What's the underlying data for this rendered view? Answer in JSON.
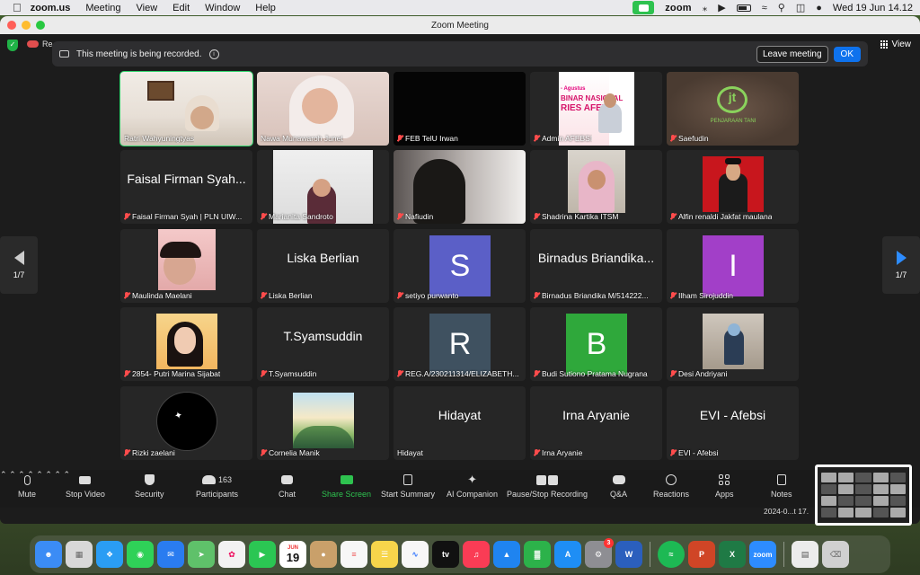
{
  "menubar": {
    "app_name": "zoom.us",
    "items": [
      "Meeting",
      "View",
      "Edit",
      "Window",
      "Help"
    ],
    "status_app": "zoom",
    "datetime": "Wed 19 Jun  14.12"
  },
  "window": {
    "title": "Zoom Meeting",
    "rec_short": "Re",
    "view_label": "View"
  },
  "recording_banner": {
    "message": "This meeting is being recorded.",
    "leave_label": "Leave meeting",
    "ok_label": "OK"
  },
  "pagination": {
    "left": "1/7",
    "right": "1/7"
  },
  "participants": [
    {
      "name": "Ratri Wahyuningtyas",
      "kind": "video",
      "muted": false,
      "active": true
    },
    {
      "name": "Nawa Munawaroh Junet",
      "kind": "video",
      "muted": false
    },
    {
      "name": "FEB TelU Irwan",
      "kind": "blank",
      "muted": true
    },
    {
      "name": "Admin AFEBSI",
      "kind": "poster",
      "muted": true,
      "poster_lines": [
        "- Agustus",
        "BINAR NASIONAL",
        "RIES AFEBSI"
      ]
    },
    {
      "name": "Saefudin",
      "kind": "logo",
      "muted": true,
      "logo_text": "PENJARAAN TANI"
    },
    {
      "name": "Faisal Firman Syah | PLN UIW...",
      "kind": "text",
      "muted": true,
      "display": "Faisal Firman Syah..."
    },
    {
      "name": "Marianita Sandroto",
      "kind": "video",
      "muted": true
    },
    {
      "name": "Nafiudin",
      "kind": "video",
      "muted": true
    },
    {
      "name": "Shadrina Kartika ITSM",
      "kind": "video",
      "muted": true
    },
    {
      "name": "Alfin renaldi Jakfat maulana",
      "kind": "photo",
      "muted": true
    },
    {
      "name": "Maulinda Maelani",
      "kind": "photo",
      "muted": true
    },
    {
      "name": "Liska Berlian",
      "kind": "text",
      "muted": true,
      "display": "Liska Berlian"
    },
    {
      "name": "setiyo purwanto",
      "kind": "avatar",
      "muted": true,
      "letter": "S",
      "color": "#5b5fc7"
    },
    {
      "name": "Birnadus Briandika M/514222...",
      "kind": "text",
      "muted": true,
      "display": "Birnadus Briandika..."
    },
    {
      "name": "Ilham Sirojuddin",
      "kind": "avatar",
      "muted": true,
      "letter": "I",
      "color": "#a23fc8"
    },
    {
      "name": "2854- Putri Marina Sijabat",
      "kind": "photo",
      "muted": true
    },
    {
      "name": "T.Syamsuddin",
      "kind": "text",
      "muted": true,
      "display": "T.Syamsuddin"
    },
    {
      "name": "REG.A/230211314/ELIZABETH...",
      "kind": "avatar",
      "muted": true,
      "letter": "R",
      "color": "#3f5160"
    },
    {
      "name": "Budi Sutiono Pratama Nugrana",
      "kind": "avatar",
      "muted": true,
      "letter": "B",
      "color": "#2fa83b"
    },
    {
      "name": "Desi Andriyani",
      "kind": "photo",
      "muted": true
    },
    {
      "name": "Rizki zaelani",
      "kind": "photo",
      "muted": true
    },
    {
      "name": "Cornelia Manik",
      "kind": "art",
      "muted": true
    },
    {
      "name": "Hidayat",
      "kind": "text",
      "muted": true,
      "display": "Hidayat"
    },
    {
      "name": "Irna Aryanie",
      "kind": "text",
      "muted": true,
      "display": "Irna Aryanie"
    },
    {
      "name": "EVI - Afebsi",
      "kind": "text",
      "muted": true,
      "display": "EVI - Afebsi"
    }
  ],
  "toolbar": {
    "mute": "Mute",
    "stop_video": "Stop Video",
    "security": "Security",
    "participants": "Participants",
    "participants_count": "163",
    "chat": "Chat",
    "share_screen": "Share Screen",
    "start_summary": "Start Summary",
    "ai_companion": "AI Companion",
    "pause_recording": "Pause/Stop Recording",
    "qa": "Q&A",
    "reactions": "Reactions",
    "apps": "Apps",
    "notes": "Notes"
  },
  "screenshot_thumb": {
    "label": "2024-0...t 17."
  },
  "dock": {
    "calendar_month": "JUN",
    "calendar_day": "19",
    "tv_label": "tv",
    "word_label": "W",
    "excel_label": "X",
    "ppt_label": "P",
    "zoom_label": "zoom",
    "badge": "3",
    "colors": {
      "finder": "#3b8cf5",
      "launchpad": "#d8d8d8",
      "safari": "#2a9df4",
      "messages": "#2fd158",
      "mail": "#2a7cf0",
      "maps": "#5fc16a",
      "photos": "#f2f2f2",
      "facetime": "#2bc653",
      "calendar": "#ffffff",
      "contacts": "#c9a06a",
      "reminders": "#f7f7f7",
      "notes": "#f7d54b",
      "freeform": "#f7f7f7",
      "tv": "#111111",
      "music": "#fa3c55",
      "keynote": "#1f84f0",
      "numbers": "#2cb24a",
      "appstore": "#1e8ef5",
      "settings": "#8e8e93",
      "word": "#2b5fbd",
      "spotify": "#1db954",
      "powerpoint": "#d04526",
      "excel": "#1f7a45",
      "zoom": "#2d8cff",
      "preview": "#ececec",
      "trash": "#d0d0d0"
    }
  }
}
